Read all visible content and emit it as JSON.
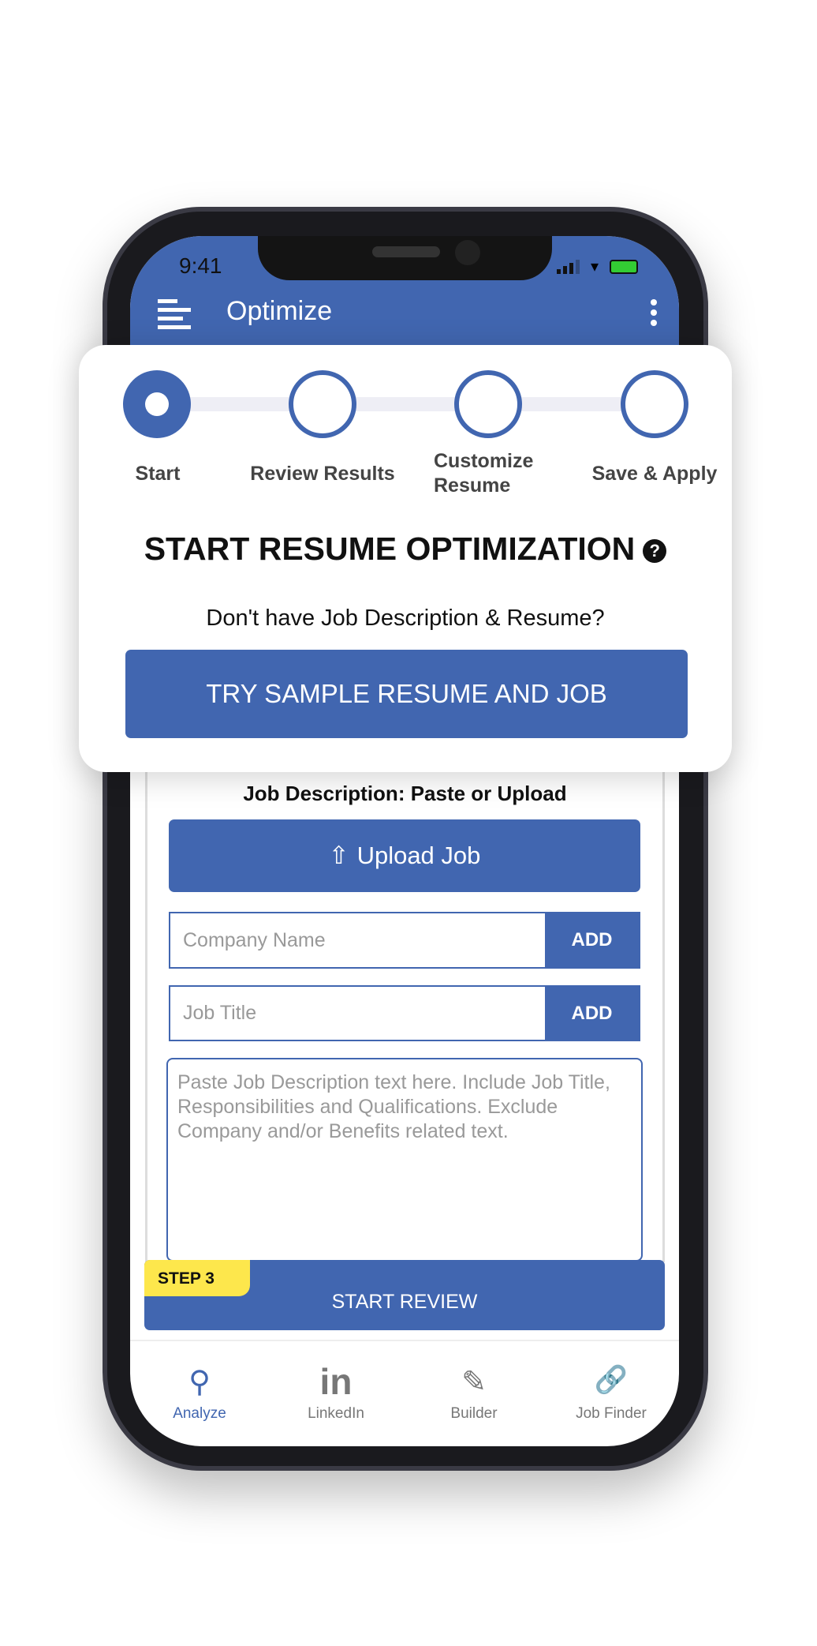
{
  "status_bar": {
    "time": "9:41"
  },
  "header": {
    "title": "Optimize",
    "menu_icon": "hamburger-icon",
    "more_icon": "kebab-icon"
  },
  "stepper": {
    "steps": [
      {
        "label": "Start",
        "active": true
      },
      {
        "label": "Review Results",
        "active": false
      },
      {
        "label": "Customize Resume",
        "active": false
      },
      {
        "label": "Save & Apply",
        "active": false
      }
    ]
  },
  "card": {
    "title": "START RESUME OPTIMIZATION",
    "help_icon": "?",
    "subtitle": "Don't have Job Description & Resume?",
    "sample_button": "TRY SAMPLE RESUME AND JOB"
  },
  "job": {
    "heading": "Job Description: Paste or Upload",
    "upload_button": "Upload Job",
    "company_placeholder": "Company Name",
    "title_placeholder": "Job Title",
    "add_label": "ADD",
    "description_placeholder": "Paste Job Description text here. Include Job Title, Responsibilities and Qualifications. Exclude Company and/or Benefits related text."
  },
  "review": {
    "step_badge": "STEP 3",
    "button": "START REVIEW"
  },
  "tabs": [
    {
      "label": "Analyze",
      "icon": "search-icon",
      "active": true
    },
    {
      "label": "LinkedIn",
      "icon": "linkedin-icon"
    },
    {
      "label": "Builder",
      "icon": "edit-icon"
    },
    {
      "label": "Job Finder",
      "icon": "link-icon"
    }
  ],
  "colors": {
    "primary": "#4166b0",
    "badge": "#fde74c"
  }
}
